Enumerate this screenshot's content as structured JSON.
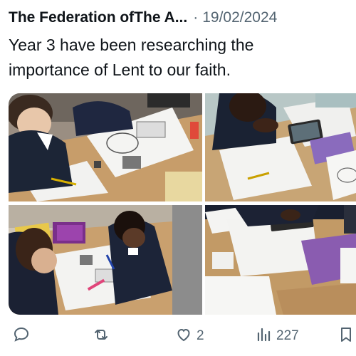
{
  "tweet": {
    "author": "The Federation ofThe A...",
    "separator": "·",
    "date": "19/02/2024",
    "text_lines": [
      "Year 3 have been researching the",
      "importance of Lent to our faith."
    ]
  },
  "media": {
    "photos": [
      {
        "name": "photo-1",
        "alt_icon": "classroom-photo"
      },
      {
        "name": "photo-2",
        "alt_icon": "classroom-photo"
      },
      {
        "name": "photo-3",
        "alt_icon": "classroom-photo"
      },
      {
        "name": "photo-4",
        "alt_icon": "classroom-photo"
      }
    ]
  },
  "actions": {
    "reply": {
      "icon": "reply-icon",
      "count": ""
    },
    "retweet": {
      "icon": "retweet-icon",
      "count": ""
    },
    "like": {
      "icon": "heart-icon",
      "count": "2"
    },
    "views": {
      "icon": "views-icon",
      "count": "227"
    },
    "bookmark": {
      "icon": "bookmark-icon",
      "count": ""
    }
  },
  "colors": {
    "text": "#0f1419",
    "secondary": "#536471",
    "desk": "#c9a070",
    "uniform": "#1b2233"
  }
}
